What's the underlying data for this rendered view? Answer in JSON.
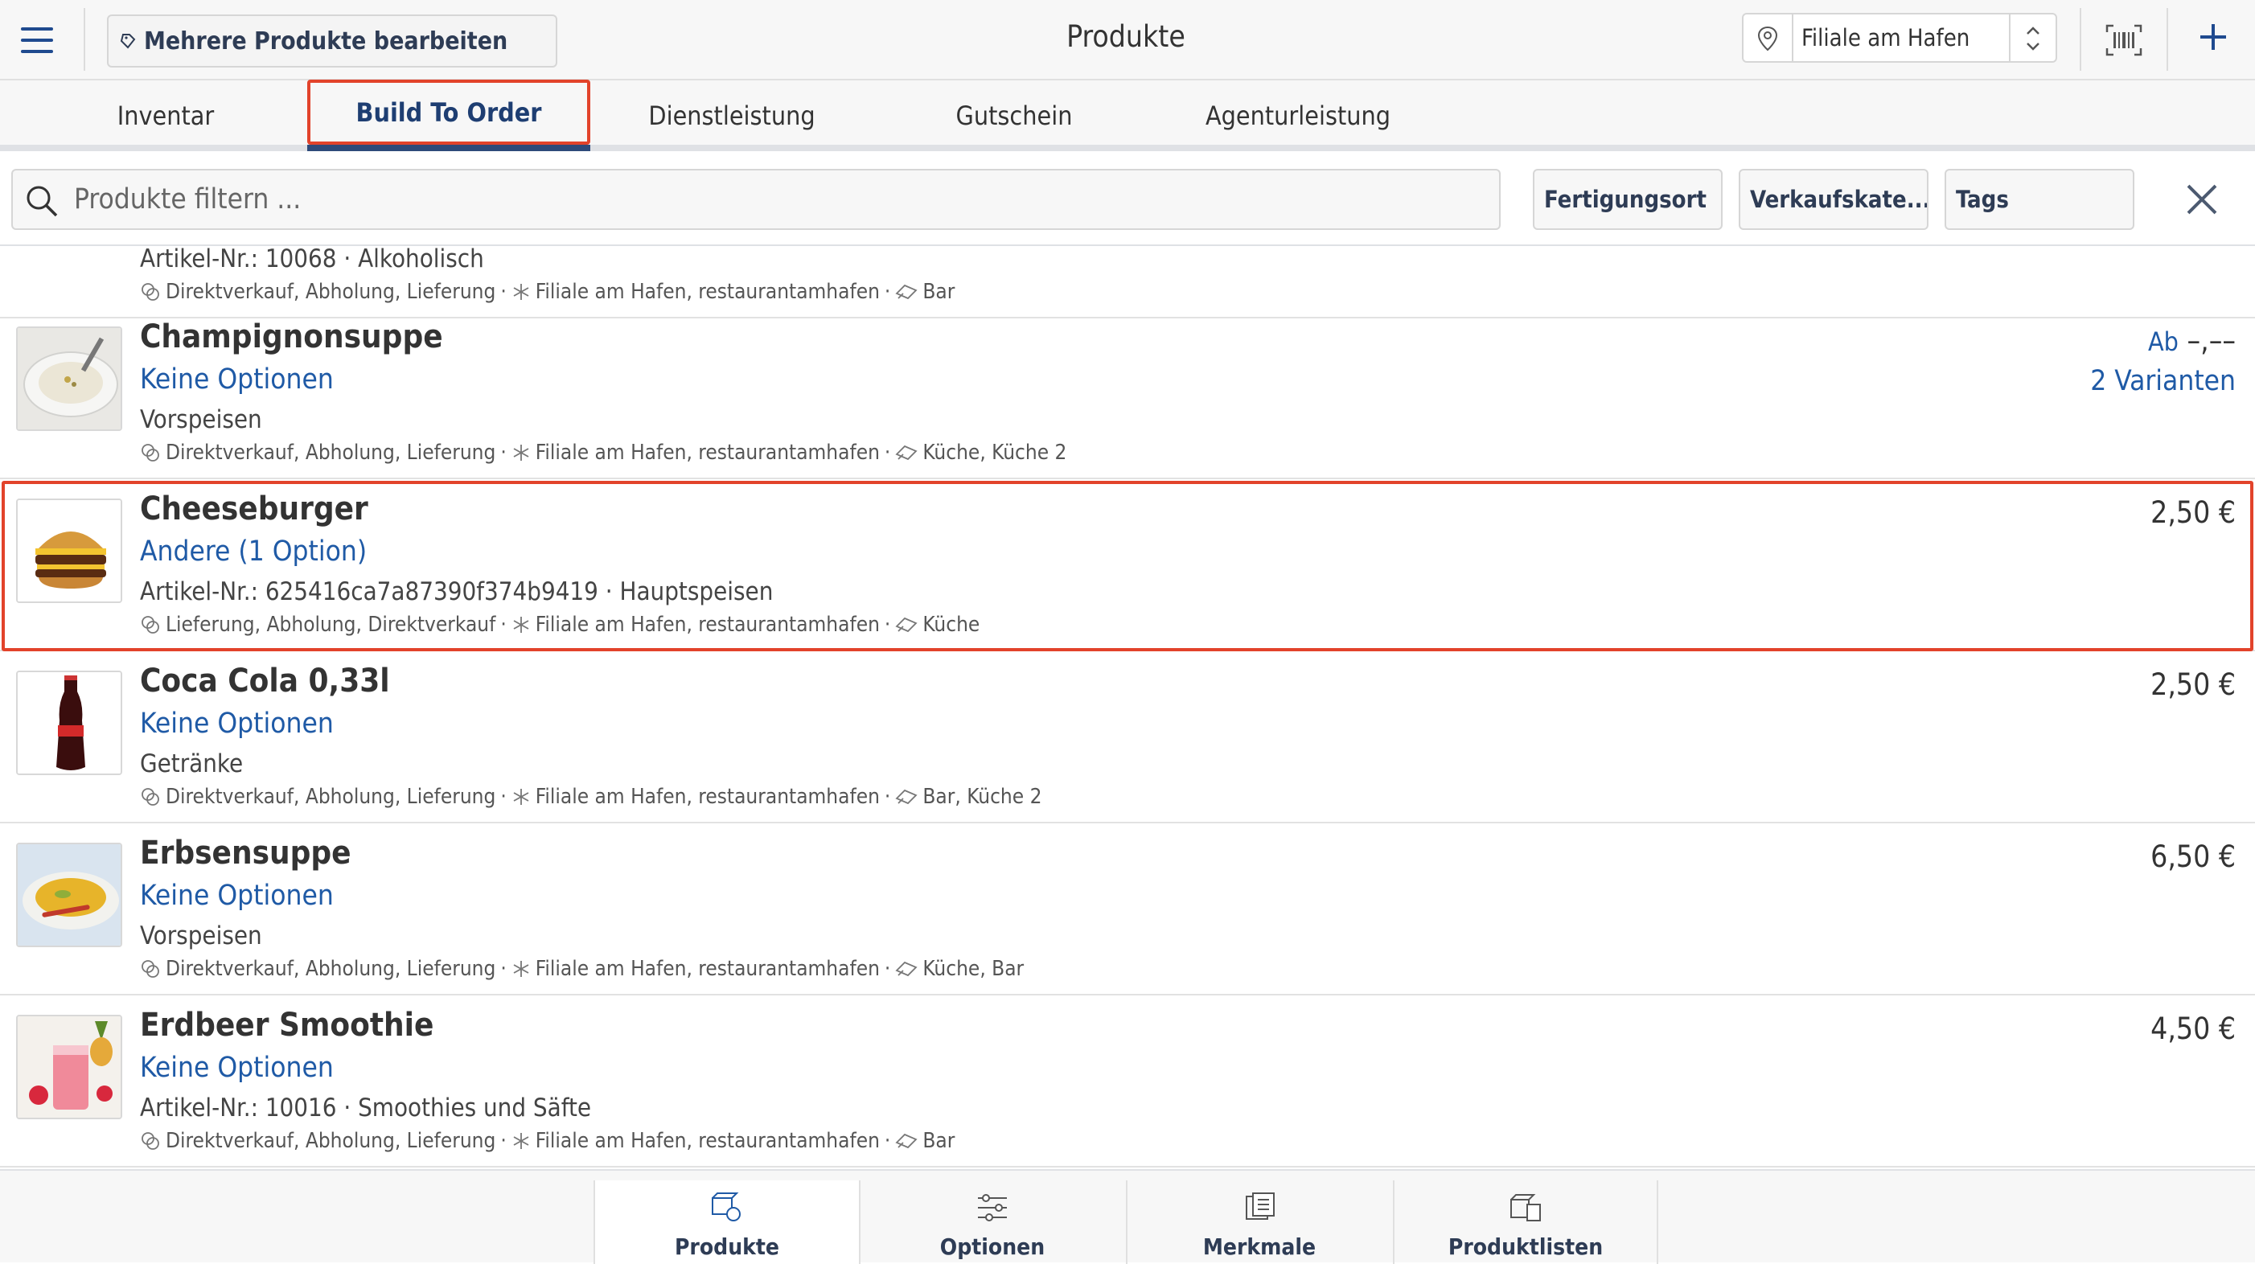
{
  "header": {
    "menu_icon": "hamburger-menu-icon",
    "bulk_edit_label": "Mehrere Produkte bearbeiten",
    "title": "Produkte",
    "branch": "Filiale am Hafen",
    "barcode_icon": "barcode-scan-icon",
    "add_icon": "plus-icon"
  },
  "tabs": [
    {
      "label": "Inventar"
    },
    {
      "label": "Build To Order"
    },
    {
      "label": "Dienstleistung"
    },
    {
      "label": "Gutschein"
    },
    {
      "label": "Agenturleistung"
    }
  ],
  "filter": {
    "search_placeholder": "Produkte filtern ...",
    "buttons": [
      {
        "label": "Fertigungsort"
      },
      {
        "label": "Verkaufskate..."
      },
      {
        "label": "Tags"
      }
    ]
  },
  "products": [
    {
      "name": "",
      "options": "",
      "category": "Artikel-Nr.: 10068 · Alkoholisch",
      "channels": "Direktverkauf, Abholung, Lieferung",
      "branches": "Filiale am Hafen, restaurantamhafen",
      "stations": "Bar",
      "price": ""
    },
    {
      "name": "Champignonsuppe",
      "options": "Keine Optionen",
      "category": "Vorspeisen",
      "channels": "Direktverkauf, Abholung, Lieferung",
      "branches": "Filiale am Hafen, restaurantamhafen",
      "stations": "Küche, Küche 2",
      "price_prefix": "Ab",
      "price": "–,––",
      "variants": "2 Varianten"
    },
    {
      "name": "Cheeseburger",
      "options": "Andere (1 Option)",
      "category": "Artikel-Nr.: 625416ca7a87390f374b9419 · Hauptspeisen",
      "channels": "Lieferung, Abholung, Direktverkauf",
      "branches": "Filiale am Hafen, restaurantamhafen",
      "stations": "Küche",
      "price": "2,50 €"
    },
    {
      "name": "Coca Cola 0,33l",
      "options": "Keine Optionen",
      "category": "Getränke",
      "channels": "Direktverkauf, Abholung, Lieferung",
      "branches": "Filiale am Hafen, restaurantamhafen",
      "stations": "Bar, Küche 2",
      "price": "2,50 €"
    },
    {
      "name": "Erbsensuppe",
      "options": "Keine Optionen",
      "category": "Vorspeisen",
      "channels": "Direktverkauf, Abholung, Lieferung",
      "branches": "Filiale am Hafen, restaurantamhafen",
      "stations": "Küche, Bar",
      "price": "6,50 €"
    },
    {
      "name": "Erdbeer Smoothie",
      "options": "Keine Optionen",
      "category": "Artikel-Nr.: 10016 · Smoothies und Säfte",
      "channels": "Direktverkauf, Abholung, Lieferung",
      "branches": "Filiale am Hafen, restaurantamhafen",
      "stations": "Bar",
      "price": "4,50 €"
    }
  ],
  "bottom_nav": [
    {
      "label": "Produkte",
      "icon": "products-icon"
    },
    {
      "label": "Optionen",
      "icon": "sliders-icon"
    },
    {
      "label": "Merkmale",
      "icon": "attributes-icon"
    },
    {
      "label": "Produktlisten",
      "icon": "product-lists-icon"
    }
  ],
  "colors": {
    "accent": "#1f5aa6",
    "highlight": "#e2432b",
    "tab_underline": "#2e4a7a"
  }
}
